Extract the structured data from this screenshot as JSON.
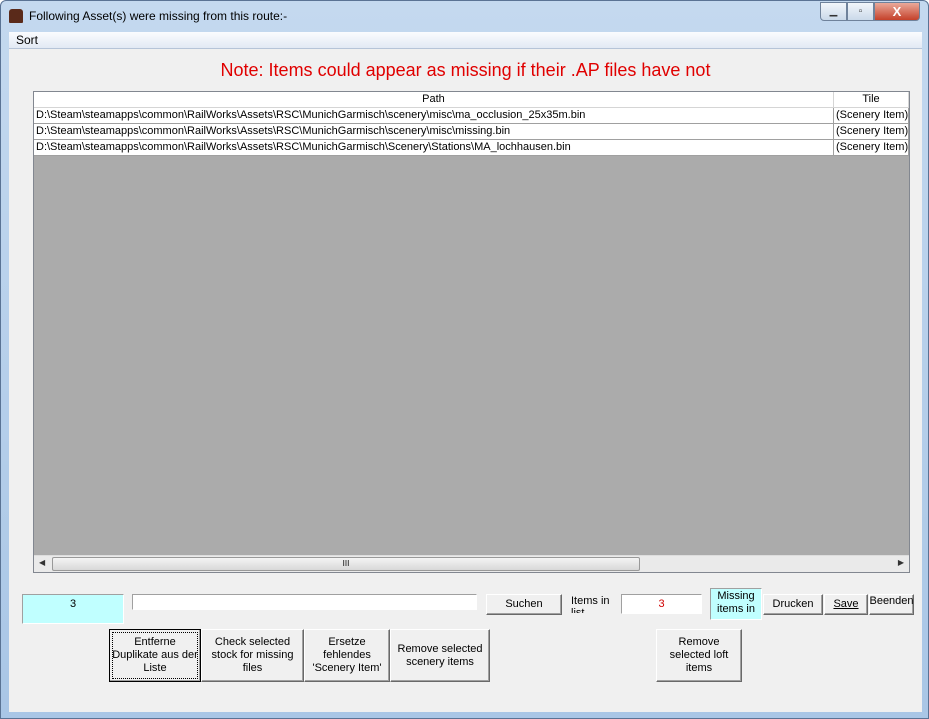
{
  "window": {
    "title": "Following Asset(s) were missing from this route:-",
    "min": "▁",
    "max": "▫",
    "close": "X"
  },
  "menu": {
    "sort": "Sort"
  },
  "note": "Note: Items could appear as missing if their .AP files have not",
  "table": {
    "columns": [
      "Path",
      "Tile"
    ],
    "rows": [
      {
        "path": "D:\\Steam\\steamapps\\common\\RailWorks\\Assets\\RSC\\MunichGarmisch\\scenery\\misc\\ma_occlusion_25x35m.bin",
        "tile": "(Scenery Item)"
      },
      {
        "path": "D:\\Steam\\steamapps\\common\\RailWorks\\Assets\\RSC\\MunichGarmisch\\scenery\\misc\\missing.bin",
        "tile": "(Scenery Item)"
      },
      {
        "path": "D:\\Steam\\steamapps\\common\\RailWorks\\Assets\\RSC\\MunichGarmisch\\Scenery\\Stations\\MA_lochhausen.bin",
        "tile": "(Scenery Item)"
      }
    ],
    "scroll_thumb": "III",
    "left_arrow": "◀",
    "right_arrow": "▶"
  },
  "bottom": {
    "count": "3",
    "search_value": "",
    "search_button": "Suchen",
    "items_in_list_label": "Items in list",
    "items_in_list_value": "3",
    "missing_items_label": "Missing items in",
    "print": "Drucken",
    "save": "Save",
    "exit": "Beenden",
    "remove_duplicates": "Entferne Duplikate aus der Liste",
    "check_stock": "Check selected stock for missing files",
    "replace_scenery": "Ersetze fehlendes 'Scenery Item'",
    "remove_scenery": "Remove selected scenery items",
    "remove_loft": "Remove selected loft items"
  }
}
